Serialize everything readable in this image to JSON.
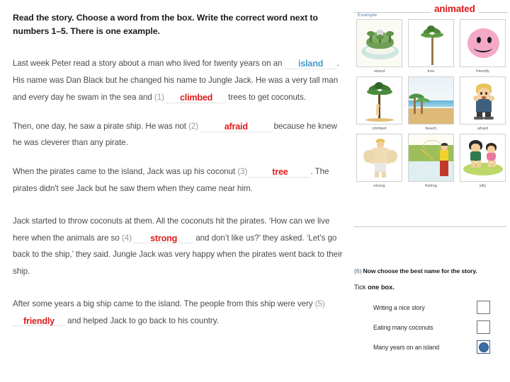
{
  "worksheet": {
    "instruction": "Read the story. Choose a word from the box. Write the correct word next to numbers 1–5. There is one example.",
    "paragraphs": {
      "p1_a": "Last week Peter read a story about a man who lived for twenty years on an",
      "p1_b": ". His name was Dan Black but he changed his name to Jungle Jack. He was a very tall man and every day he swam in the sea and",
      "p1_num": "(1)",
      "p1_c": "trees to get coconuts.",
      "p2_a": "Then, one day, he saw a pirate ship. He was not",
      "p2_num": "(2)",
      "p2_b": "because he knew he was cleverer than any pirate.",
      "p3_a": "When the pirates came to the island, Jack was up his coconut",
      "p3_num": "(3)",
      "p3_b": ". The pirates didn't see Jack but he saw them when they came near him.",
      "p4_a": "Jack started to throw coconuts at them. All the coconuts hit the pirates. ‘How can we live here when the animals are so",
      "p4_num": "(4)",
      "p4_b": "and don’t like us?’ they asked. ‘Let’s go back to the ship,’ they said. Jungle Jack was very happy when the pirates went back to their ship.",
      "p5_a": "After some years a big ship came to the island. The people from this ship were very",
      "p5_num": "(5)",
      "p5_b": "and helped Jack to go back to his country."
    },
    "answers": {
      "example": "island",
      "a1": "climbed",
      "a2": "afraid",
      "a3": "tree",
      "a4": "strong",
      "a5": "friendly"
    }
  },
  "word_box": {
    "animated_label": "animated",
    "example_label": "Example",
    "rows": [
      [
        {
          "label": "island",
          "icon": "island-illustration"
        },
        {
          "label": "tree",
          "icon": "palm-tree-illustration"
        },
        {
          "label": "friendly",
          "icon": "smiley-face-illustration"
        }
      ],
      [
        {
          "label": "climbed",
          "icon": "person-climbing-tree-illustration"
        },
        {
          "label": "beach",
          "icon": "beach-illustration"
        },
        {
          "label": "afraid",
          "icon": "scared-boy-illustration"
        }
      ],
      [
        {
          "label": "strong",
          "icon": "muscular-man-illustration"
        },
        {
          "label": "fishing",
          "icon": "fishing-illustration"
        },
        {
          "label": "silly",
          "icon": "two-children-illustration"
        }
      ]
    ]
  },
  "question": {
    "number": "(6)",
    "prompt": "Now choose the best name for the story.",
    "tick_bold_a": "Tick ",
    "tick_rest": "one box.",
    "options": [
      {
        "label": "Writing a nice story",
        "selected": false
      },
      {
        "label": "Eating many coconuts",
        "selected": false
      },
      {
        "label": "Many years on an island",
        "selected": true
      }
    ]
  },
  "colors": {
    "answer_red": "#e01b1b",
    "answer_blue": "#4a9cc7",
    "radio_blue": "#3a6ea5"
  }
}
